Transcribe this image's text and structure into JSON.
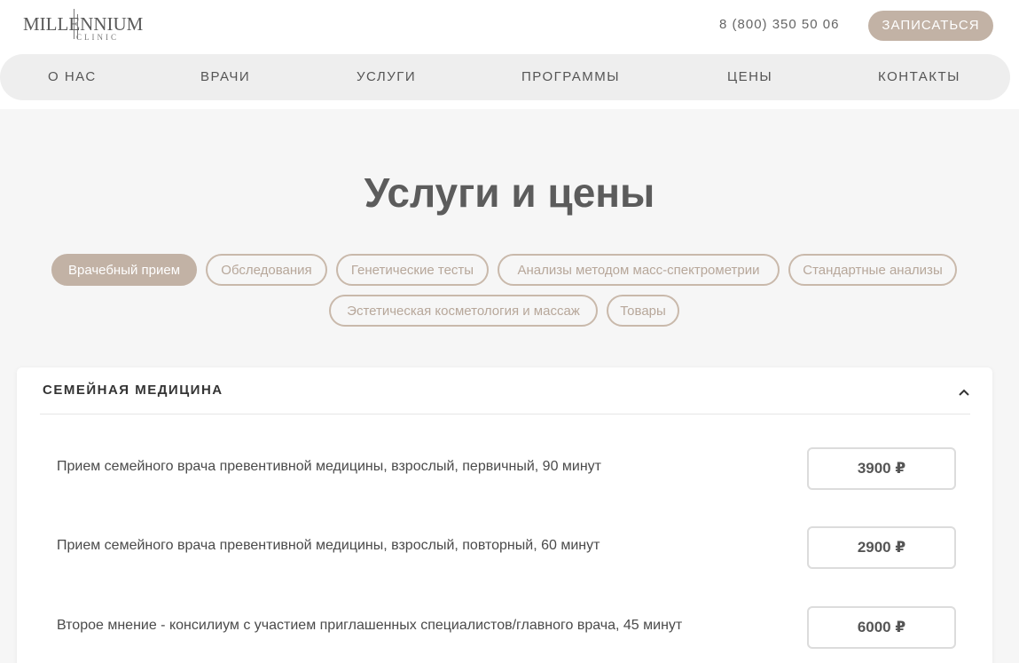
{
  "header": {
    "logo": {
      "word": "MILLENNIUM",
      "sub": "CLINIC"
    },
    "phone": "8 (800) 350 50 06",
    "cta_label": "ЗАПИСАТЬСЯ"
  },
  "nav": {
    "items": [
      "О НАС",
      "ВРАЧИ",
      "УСЛУГИ",
      "ПРОГРАММЫ",
      "ЦЕНЫ",
      "КОНТАКТЫ"
    ]
  },
  "page": {
    "title": "Услуги и цены"
  },
  "filters": {
    "active_index": 0,
    "items": [
      "Врачебный прием",
      "Обследования",
      "Генетические тесты",
      "Анализы методом масс-спектрометрии",
      "Стандартные анализы",
      "Эстетическая косметология и массаж",
      "Товары"
    ]
  },
  "section": {
    "title": "СЕМЕЙНАЯ МЕДИЦИНА",
    "expanded": true,
    "rows": [
      {
        "label": "Прием семейного врача превентивной медицины, взрослый, первичный, 90 минут",
        "price": "3900 ₽"
      },
      {
        "label": "Прием семейного врача превентивной медицины, взрослый, повторный, 60 минут",
        "price": "2900 ₽"
      },
      {
        "label": "Второе мнение - консилиум с участием приглашенных специалистов/главного врача, 45 минут",
        "price": "6000 ₽"
      }
    ]
  },
  "colors": {
    "accent": "#c2b2a5",
    "background": "#f6f6f6",
    "nav_bg": "#eeeeee"
  },
  "icons": {
    "collapse": "chevron-up-icon"
  }
}
